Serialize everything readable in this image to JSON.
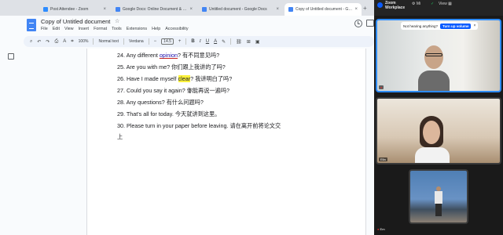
{
  "browser": {
    "tabs": [
      {
        "title": "Post Attendee - Zoom",
        "favicon_color": "#2d8cff",
        "active": false
      },
      {
        "title": "Google Docs: Online Document & P...",
        "favicon_color": "#4285f4",
        "active": false
      },
      {
        "title": "Untitled document - Google Docs",
        "favicon_color": "#4285f4",
        "active": false
      },
      {
        "title": "Copy of Untitled document - Google...",
        "favicon_color": "#4285f4",
        "active": true
      }
    ],
    "close_glyph": "×",
    "new_tab_glyph": "+"
  },
  "docs": {
    "title": "Copy of Untitled document",
    "star_glyph": "☆",
    "menu": [
      "File",
      "Edit",
      "View",
      "Insert",
      "Format",
      "Tools",
      "Extensions",
      "Help",
      "Accessibility"
    ],
    "toolbar": {
      "search_glyph": "⌕",
      "undo_glyph": "↶",
      "redo_glyph": "↷",
      "print_glyph": "⎙",
      "spell_glyph": "A",
      "paint_glyph": "⌗",
      "zoom": "100%",
      "style": "Normal text",
      "font": "Verdana",
      "font_size": "14.5",
      "minus_glyph": "−",
      "plus_glyph": "+",
      "bold": "B",
      "italic": "I",
      "underline": "U",
      "text_color": "A",
      "highlight_glyph": "✎",
      "link_glyph": "⛓",
      "comment_glyph": "⊞",
      "image_glyph": "▣"
    },
    "lines": [
      {
        "pre": "24. Any different ",
        "word": "opinion",
        "post": "? 有不同意见吗?"
      },
      {
        "text": "25. Are you with me? 你们跟上我讲的了吗?"
      },
      {
        "pre": "26. Have I made myself ",
        "word": "clear",
        "post": "? 我讲明白了吗?"
      },
      {
        "text": "27. Could you say it again? 你能再说一遍吗?"
      },
      {
        "text": "28. Any questions? 有什么问题吗?"
      },
      {
        "text": "29. That's all for today. 今天就讲到这里。"
      },
      {
        "text": "30. Please turn in your paper before leaving. 请在离开前将论文交"
      },
      {
        "text": "上"
      }
    ]
  },
  "zoom": {
    "app_name_1": "Zoom",
    "app_name_2": "Workplace",
    "top_icons": {
      "a": "⚙ Mi",
      "b": "✓",
      "c": "View ▦"
    },
    "audio_prompt": "Not hearing anything?",
    "audio_button": "Turn up volume",
    "audio_close": "×",
    "tile_labels": [
      "",
      "Ella",
      ""
    ],
    "bottom_label": "Em"
  }
}
